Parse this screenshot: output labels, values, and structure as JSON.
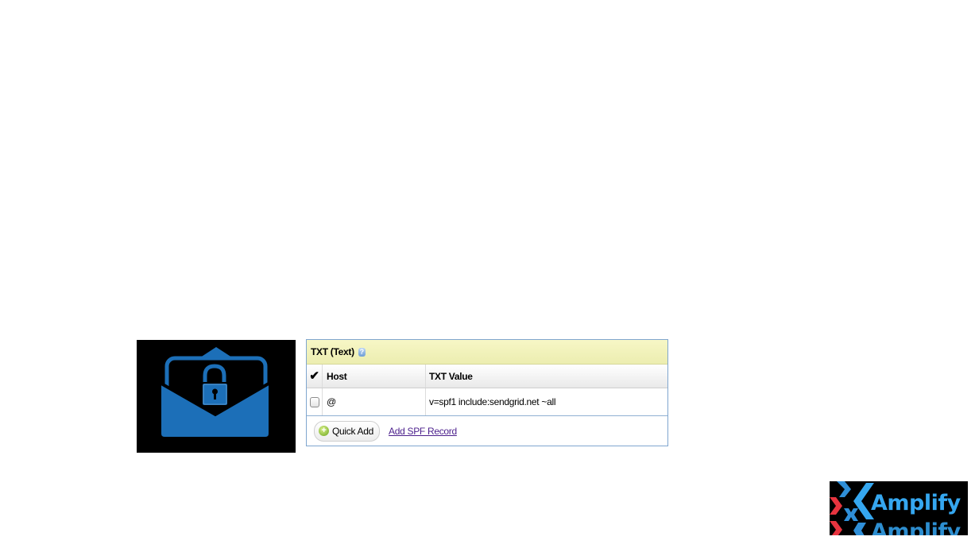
{
  "txt_panel": {
    "title": "TXT (Text)",
    "help_icon": "question-icon",
    "columns": {
      "check": "✔",
      "host": "Host",
      "value": "TXT Value"
    },
    "records": [
      {
        "host": "@",
        "value": "v=spf1 include:sendgrid.net ~all",
        "checked": false
      }
    ],
    "quick_add_label": "Quick Add",
    "add_spf_label": "Add SPF Record"
  },
  "mail_image": {
    "icon": "envelope-lock-icon",
    "color": "#1c6fb8",
    "background": "#000000"
  },
  "logo": {
    "text": "Amplify",
    "text_repeat": "Amplify",
    "colors": {
      "blue": "#35a7f0",
      "red": "#e8343f",
      "background": "#000000"
    }
  }
}
